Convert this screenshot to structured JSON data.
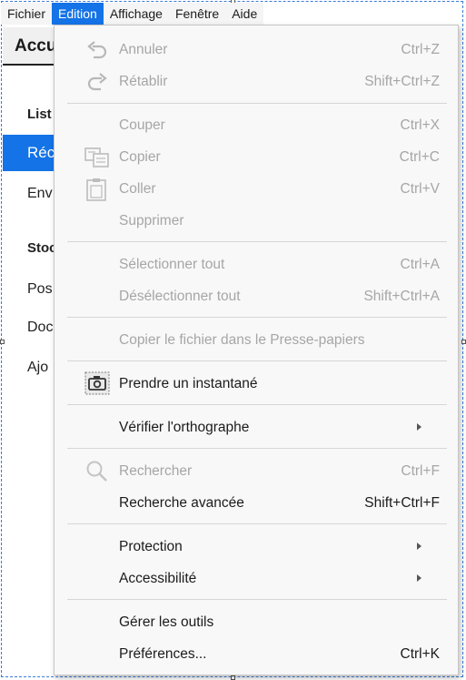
{
  "menubar": {
    "items": [
      "Fichier",
      "Edition",
      "Affichage",
      "Fenêtre",
      "Aide"
    ],
    "active_index": 1
  },
  "background": {
    "tab_label": "Accu",
    "lines": [
      "List",
      "Réc",
      "Env",
      "Stoc",
      "Pos",
      "Doc",
      "Ajo"
    ]
  },
  "menu": {
    "undo": {
      "label": "Annuler",
      "shortcut": "Ctrl+Z",
      "icon": "undo-icon",
      "enabled": false
    },
    "redo": {
      "label": "Rétablir",
      "shortcut": "Shift+Ctrl+Z",
      "icon": "redo-icon",
      "enabled": false
    },
    "cut": {
      "label": "Couper",
      "shortcut": "Ctrl+X",
      "enabled": false
    },
    "copy": {
      "label": "Copier",
      "shortcut": "Ctrl+C",
      "icon": "copy-icon",
      "enabled": false
    },
    "paste": {
      "label": "Coller",
      "shortcut": "Ctrl+V",
      "icon": "clipboard-icon",
      "enabled": false
    },
    "delete": {
      "label": "Supprimer",
      "enabled": false
    },
    "select_all": {
      "label": "Sélectionner tout",
      "shortcut": "Ctrl+A",
      "enabled": false
    },
    "deselect_all": {
      "label": "Désélectionner tout",
      "shortcut": "Shift+Ctrl+A",
      "enabled": false
    },
    "copy_file": {
      "label": "Copier le fichier dans le Presse-papiers",
      "enabled": false
    },
    "snapshot": {
      "label": "Prendre un instantané",
      "icon": "camera-icon",
      "enabled": true
    },
    "spell_check": {
      "label": "Vérifier l'orthographe",
      "submenu": true,
      "enabled": true
    },
    "find": {
      "label": "Rechercher",
      "shortcut": "Ctrl+F",
      "icon": "search-icon",
      "enabled": false
    },
    "advanced_search": {
      "label": "Recherche avancée",
      "shortcut": "Shift+Ctrl+F",
      "enabled": true
    },
    "protection": {
      "label": "Protection",
      "submenu": true,
      "enabled": true
    },
    "accessibility": {
      "label": "Accessibilité",
      "submenu": true,
      "enabled": true
    },
    "manage_tools": {
      "label": "Gérer les outils",
      "enabled": true
    },
    "preferences": {
      "label": "Préférences...",
      "shortcut": "Ctrl+K",
      "enabled": true
    }
  },
  "colors": {
    "accent": "#1473e6",
    "disabled_text": "#a6a6a6",
    "menu_bg": "#f8f8f8"
  }
}
